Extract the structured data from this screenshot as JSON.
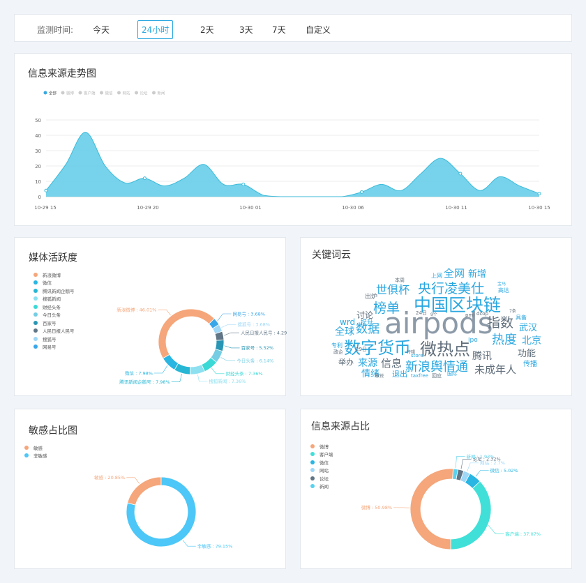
{
  "monitor": {
    "label": "监测时间:",
    "options": [
      "今天",
      "24小时",
      "2天",
      "3天",
      "7天",
      "自定义"
    ],
    "selected": "24小时"
  },
  "source_trend": {
    "title": "信息来源走势图",
    "legend": [
      "全部",
      "微博",
      "客户端",
      "微信",
      "网站",
      "论坛",
      "新闻"
    ],
    "legend_active_color": "#3aa8df",
    "legend_inactive_color": "#cccccc",
    "chart_data": {
      "type": "area",
      "x_ticks": [
        "10-29 15",
        "10-29 20",
        "10-30 01",
        "10-30 06",
        "10-30 11",
        "10-30 15"
      ],
      "y_ticks": [
        0,
        10,
        20,
        30,
        40,
        50
      ],
      "ylim": [
        0,
        55
      ],
      "grid": true,
      "series": [
        {
          "name": "全部",
          "color": "#5ecbe8",
          "points": [
            {
              "x": 0,
              "y": 4
            },
            {
              "x": 1,
              "y": 21
            },
            {
              "x": 2,
              "y": 42
            },
            {
              "x": 3,
              "y": 20
            },
            {
              "x": 4,
              "y": 9
            },
            {
              "x": 5,
              "y": 12
            },
            {
              "x": 6,
              "y": 7
            },
            {
              "x": 7,
              "y": 12
            },
            {
              "x": 8,
              "y": 21
            },
            {
              "x": 9,
              "y": 8
            },
            {
              "x": 10,
              "y": 8
            },
            {
              "x": 11,
              "y": 1
            },
            {
              "x": 12,
              "y": 0
            },
            {
              "x": 13,
              "y": 0
            },
            {
              "x": 14,
              "y": 0
            },
            {
              "x": 15,
              "y": 0
            },
            {
              "x": 16,
              "y": 3
            },
            {
              "x": 17,
              "y": 8
            },
            {
              "x": 18,
              "y": 4
            },
            {
              "x": 19,
              "y": 15
            },
            {
              "x": 20,
              "y": 25
            },
            {
              "x": 21,
              "y": 15
            },
            {
              "x": 22,
              "y": 4
            },
            {
              "x": 23,
              "y": 13
            },
            {
              "x": 24,
              "y": 7
            },
            {
              "x": 25,
              "y": 2
            }
          ]
        }
      ]
    }
  },
  "media_activity": {
    "title": "媒体活跃度",
    "chart_data": {
      "type": "pie",
      "slices": [
        {
          "name": "新浪微博",
          "value": 46.01,
          "color": "#f5a67a",
          "label": "新浪微博 : 46.01%"
        },
        {
          "name": "微信",
          "value": 7.98,
          "color": "#29b6e3",
          "label": "微信 : 7.98%"
        },
        {
          "name": "腾讯新闻企鹅号",
          "value": 7.98,
          "color": "#27b7d4",
          "label": "腾讯新闻企鹅号 : 7.98%"
        },
        {
          "name": "搜狐新闻",
          "value": 7.36,
          "color": "#8ce0f0",
          "label": "搜狐新闻 : 7.36%"
        },
        {
          "name": "财经头条",
          "value": 7.36,
          "color": "#3ad9d6",
          "label": "财经头条 : 7.36%"
        },
        {
          "name": "今日头条",
          "value": 6.14,
          "color": "#74cde3",
          "label": "今日头条 : 6.14%"
        },
        {
          "name": "百家号",
          "value": 5.52,
          "color": "#2a96b5",
          "label": "百家号 : 5.52%"
        },
        {
          "name": "人民日报人民号",
          "value": 4.29,
          "color": "#607585",
          "label": "人民日报人民号 : 4.29%"
        },
        {
          "name": "搜狐号",
          "value": 3.68,
          "color": "#9fd7f7",
          "label": "搜狐号 : 3.68%"
        },
        {
          "name": "网易号",
          "value": 3.68,
          "color": "#3aa6ea",
          "label": "网易号 : 3.68%"
        }
      ]
    }
  },
  "keyword_cloud": {
    "title": "关键词云",
    "words": [
      {
        "text": "airpods",
        "size": 42,
        "color": "#8c9aa8"
      },
      {
        "text": "中国区块链",
        "size": 25,
        "color": "#2aa7e0"
      },
      {
        "text": "数字货币",
        "size": 24,
        "color": "#2aa7e0"
      },
      {
        "text": "微热点",
        "size": 24,
        "color": "#5f6d7a"
      },
      {
        "text": "央行凌美仕",
        "size": 19,
        "color": "#2aa7e0"
      },
      {
        "text": "榜单",
        "size": 19,
        "color": "#2aa7e0"
      },
      {
        "text": "指数",
        "size": 19,
        "color": "#5f6d7a"
      },
      {
        "text": "新浪舆情通",
        "size": 18,
        "color": "#2aa7e0"
      },
      {
        "text": "热度",
        "size": 18,
        "color": "#2aa7e0"
      },
      {
        "text": "数据",
        "size": 17,
        "color": "#2aa7e0"
      },
      {
        "text": "世俱杯",
        "size": 16,
        "color": "#2aa7e0"
      },
      {
        "text": "全网",
        "size": 15,
        "color": "#2aa7e0"
      },
      {
        "text": "未成年人",
        "size": 15,
        "color": "#5f6d7a"
      },
      {
        "text": "信息",
        "size": 15,
        "color": "#5f6d7a"
      },
      {
        "text": "来源",
        "size": 14,
        "color": "#2aa7e0"
      },
      {
        "text": "腾讯",
        "size": 14,
        "color": "#5f6d7a"
      },
      {
        "text": "北京",
        "size": 14,
        "color": "#2aa7e0"
      },
      {
        "text": "全球",
        "size": 14,
        "color": "#2aa7e0"
      },
      {
        "text": "新增",
        "size": 13,
        "color": "#2aa7e0"
      },
      {
        "text": "功能",
        "size": 13,
        "color": "#5f6d7a"
      },
      {
        "text": "武汉",
        "size": 13,
        "color": "#2aa7e0"
      },
      {
        "text": "情绪",
        "size": 13,
        "color": "#2aa7e0"
      },
      {
        "text": "讨论",
        "size": 12,
        "color": "#5f6d7a"
      },
      {
        "text": "wrd",
        "size": 12,
        "color": "#2aa7e0"
      },
      {
        "text": "举办",
        "size": 11,
        "color": "#5f6d7a"
      },
      {
        "text": "退出",
        "size": 11,
        "color": "#2aa7e0"
      },
      {
        "text": "传播",
        "size": 10,
        "color": "#2aa7e0"
      },
      {
        "text": "出炉",
        "size": 9,
        "color": "#5f6d7a"
      },
      {
        "text": "提升",
        "size": 9,
        "color": "#2aa7e0"
      },
      {
        "text": "ipo",
        "size": 9,
        "color": "#2aa7e0"
      },
      {
        "text": "专利",
        "size": 8,
        "color": "#2aa7e0"
      },
      {
        "text": "具备",
        "size": 8,
        "color": "#2aa7e0"
      },
      {
        "text": "高达",
        "size": 8,
        "color": "#2aa7e0"
      },
      {
        "text": "上网",
        "size": 8,
        "color": "#2aa7e0"
      },
      {
        "text": "24日",
        "size": 7,
        "color": "#5f6d7a"
      },
      {
        "text": "29日",
        "size": 7,
        "color": "#5f6d7a"
      },
      {
        "text": "本周",
        "size": 7,
        "color": "#5f6d7a"
      },
      {
        "text": "dcop",
        "size": 7,
        "color": "#5f6d7a"
      },
      {
        "text": "pmi",
        "size": 7,
        "color": "#5f6d7a"
      },
      {
        "text": "taxfree",
        "size": 7,
        "color": "#2aa7e0"
      },
      {
        "text": "store",
        "size": 7,
        "color": "#2aa7e0"
      },
      {
        "text": "回应",
        "size": 7,
        "color": "#5f6d7a"
      },
      {
        "text": "国际",
        "size": 7,
        "color": "#2aa7e0"
      },
      {
        "text": "政企",
        "size": 7,
        "color": "#5f6d7a"
      },
      {
        "text": "敏锐",
        "size": 6,
        "color": "#5f6d7a"
      },
      {
        "text": "特辑",
        "size": 6,
        "color": "#5f6d7a"
      },
      {
        "text": "9个",
        "size": 6,
        "color": "#5f6d7a"
      },
      {
        "text": "宝马",
        "size": 6,
        "color": "#2aa7e0"
      },
      {
        "text": "7条",
        "size": 6,
        "color": "#5f6d7a"
      }
    ]
  },
  "sensitive_ratio": {
    "title": "敏感占比图",
    "chart_data": {
      "type": "pie",
      "slices": [
        {
          "name": "敏感",
          "value": 20.85,
          "color": "#f5a67a",
          "label": "敏感 : 20.85%"
        },
        {
          "name": "非敏感",
          "value": 79.15,
          "color": "#4cc7f7",
          "label": "非敏感 : 79.15%"
        }
      ]
    }
  },
  "source_ratio": {
    "title": "信息来源占比",
    "chart_data": {
      "type": "pie",
      "slices": [
        {
          "name": "微博",
          "value": 50.98,
          "color": "#f5a67a",
          "label": "微博 : 50.98%"
        },
        {
          "name": "客户端",
          "value": 37.07,
          "color": "#40e0d8",
          "label": "客户端 : 37.07%"
        },
        {
          "name": "微信",
          "value": 5.02,
          "color": "#29b6e3",
          "label": "微信 : 5.02%"
        },
        {
          "name": "网站",
          "value": 2.7,
          "color": "#9fd7f7",
          "label": "网站 : 2.7%"
        },
        {
          "name": "论坛",
          "value": 2.32,
          "color": "#607585",
          "label": "论坛 : 2.32%"
        },
        {
          "name": "新闻",
          "value": 1.93,
          "color": "#58d2ee",
          "label": "新闻 : 1.93%"
        }
      ]
    }
  }
}
